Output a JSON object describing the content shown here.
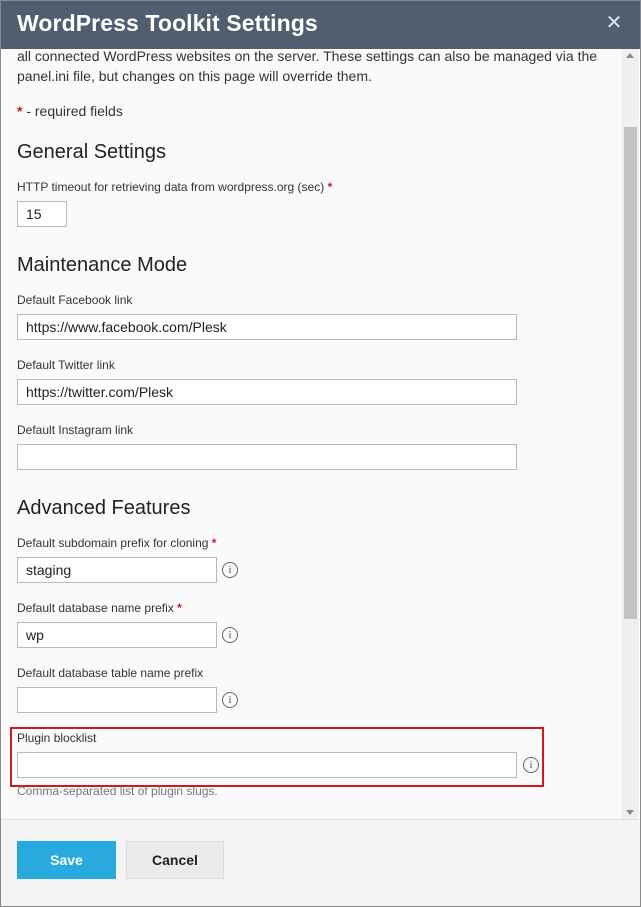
{
  "dialog": {
    "title": "WordPress Toolkit Settings",
    "close_glyph": "✕"
  },
  "intro": {
    "text": "all connected WordPress websites on the server. These settings can also be managed via the panel.ini file, but changes on this page will override them."
  },
  "required_note": {
    "star": "*",
    "text": " - required fields"
  },
  "general": {
    "heading": "General Settings",
    "http_timeout": {
      "label": "HTTP timeout for retrieving data from wordpress.org (sec)",
      "value": "15",
      "required": "*"
    }
  },
  "maintenance": {
    "heading": "Maintenance Mode",
    "facebook": {
      "label": "Default Facebook link",
      "value": "https://www.facebook.com/Plesk"
    },
    "twitter": {
      "label": "Default Twitter link",
      "value": "https://twitter.com/Plesk"
    },
    "instagram": {
      "label": "Default Instagram link",
      "value": ""
    }
  },
  "advanced": {
    "heading": "Advanced Features",
    "subdomain_prefix": {
      "label": "Default subdomain prefix for cloning",
      "value": "staging",
      "required": "*"
    },
    "db_name_prefix": {
      "label": "Default database name prefix",
      "value": "wp",
      "required": "*"
    },
    "db_table_prefix": {
      "label": "Default database table name prefix",
      "value": ""
    },
    "plugin_blocklist": {
      "label": "Plugin blocklist",
      "value": "",
      "hint": "Comma-separated list of plugin slugs."
    },
    "info_glyph": "i"
  },
  "footer": {
    "save_label": "Save",
    "cancel_label": "Cancel"
  },
  "colors": {
    "titlebar": "#4f5f6f",
    "accent": "#28aade",
    "required": "#d0191f",
    "highlight": "#d0191f"
  },
  "icons": [
    "close-icon",
    "info-icon",
    "scroll-up-arrow-icon",
    "scroll-down-arrow-icon"
  ]
}
